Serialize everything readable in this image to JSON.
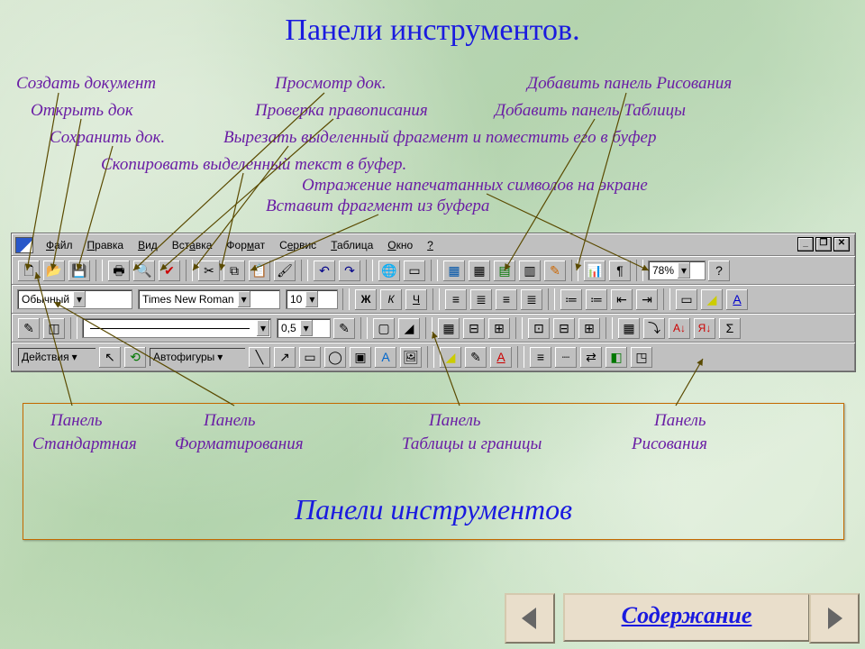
{
  "title": "Панели инструментов.",
  "labels": {
    "create": "Создать документ",
    "open": "Открыть док",
    "save": "Сохранить док.",
    "copy": "Скопировать выделенный текст в буфер.",
    "preview": "Просмотр док.",
    "spell": "Проверка правописания",
    "cut": "Вырезать выделенный фрагмент и поместить его в буфер",
    "showchars": "Отражение напечатанных символов на экране",
    "paste": "Вставит фрагмент из буфера",
    "adddraw": "Добавить панель Рисования",
    "addtable": "Добавить панель Таблицы"
  },
  "menu": [
    "Файл",
    "Правка",
    "Вид",
    "Вставка",
    "Формат",
    "Сервис",
    "Таблица",
    "Окно",
    "?"
  ],
  "fmt": {
    "style": "Обычный",
    "font": "Times New Roman",
    "size": "10"
  },
  "zoom": "78%",
  "linew": "0,5",
  "actions": "Действия",
  "autoshapes": "Автофигуры",
  "panels": {
    "p": "Панель",
    "p1": "Стандартная",
    "p2": "Форматирования",
    "p3": "Таблицы и границы",
    "p4": "Рисования"
  },
  "bigtitle": "Панели инструментов",
  "contents": "Содержание",
  "icons": {
    "new": "▫",
    "open": "📂",
    "save": "💾",
    "print": "🖶",
    "preview": "🔍",
    "spell": "✔",
    "cut": "✂",
    "copy": "⧉",
    "paste": "📋",
    "fmtp": "🖌",
    "undo": "↶",
    "redo": "↷",
    "link": "🔗",
    "web": "🌐",
    "table": "▦",
    "excel": "▤",
    "draw": "✎",
    "chart": "📊",
    "para": "¶",
    "bold": "Ж",
    "italic": "К",
    "under": "Ч",
    "left": "≡",
    "center": "≣",
    "right": "≡",
    "just": "≣",
    "num": "≔",
    "bul": "≔",
    "outd": "⇤",
    "ind": "⇥",
    "border": "▭",
    "hl": "⬛",
    "fcolor": "A",
    "pencil": "✎",
    "eraser": "◫",
    "line": "—",
    "fill": "🪣",
    "tl": "⊞",
    "merge": "⊟",
    "split": "⊞",
    "aln": "⊡",
    "dist": "⊟",
    "asc": "A",
    "desc": "Я",
    "sel": "↖",
    "rot": "⟲",
    "tline": "╲",
    "arrow": "↗",
    "rect": "▭",
    "oval": "◯",
    "text": "T",
    "wart": "A",
    "clip": "🖼",
    "3d": "▣",
    "shadow": "◧"
  }
}
